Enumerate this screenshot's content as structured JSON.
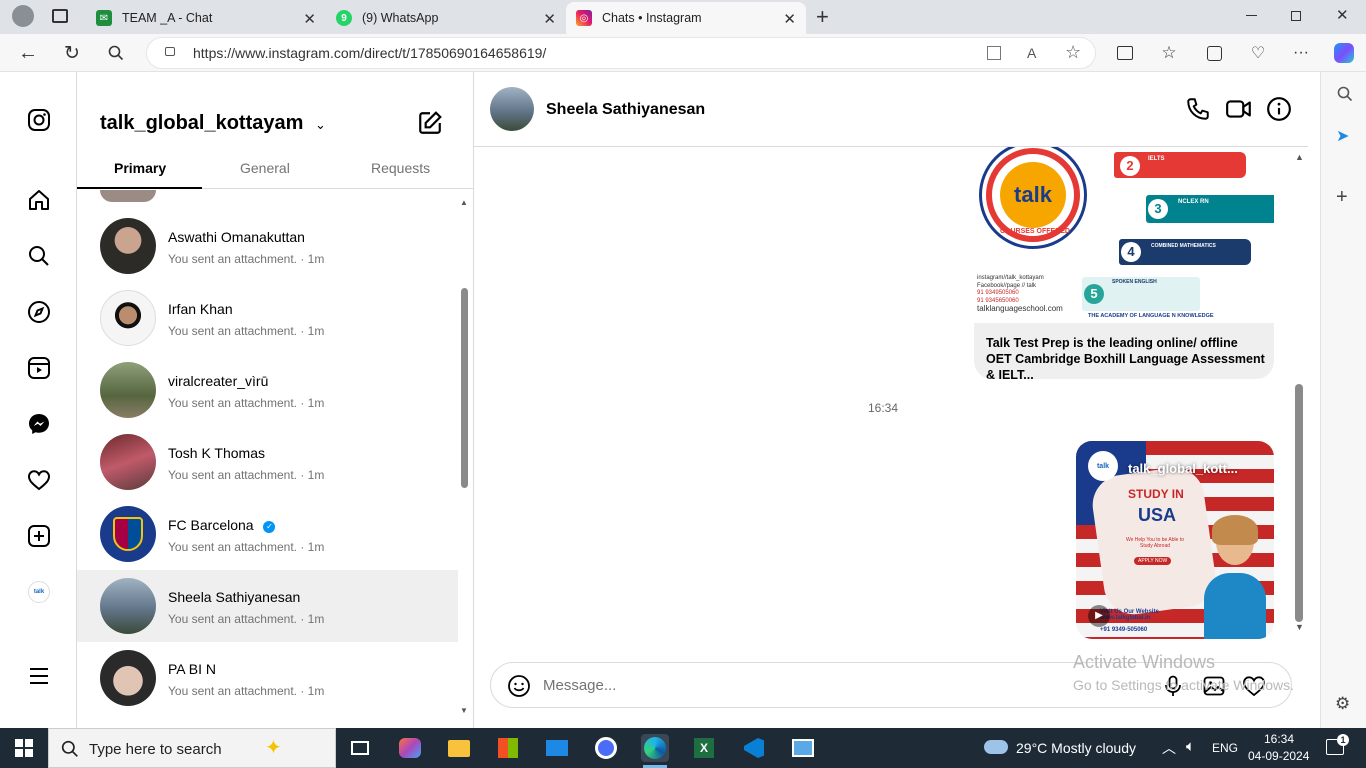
{
  "browser": {
    "tabs": [
      {
        "title": "TEAM _A - Chat",
        "icon": "google-chat-icon"
      },
      {
        "title": "(9) WhatsApp",
        "icon": "whatsapp-icon"
      },
      {
        "title": "Chats • Instagram",
        "icon": "instagram-icon",
        "active": true
      }
    ],
    "url": "https://www.instagram.com/direct/t/17850690164658619/"
  },
  "inbox": {
    "username": "talk_global_kottayam",
    "tabs": [
      "Primary",
      "General",
      "Requests"
    ],
    "active_tab": "Primary",
    "conversations": [
      {
        "name": "Aswathi Omanakuttan",
        "preview": "You sent an attachment. · 1m",
        "avatar_color": "#3b3a35"
      },
      {
        "name": "Irfan Khan",
        "preview": "You sent an attachment. · 1m",
        "avatar_color": "#ffffff"
      },
      {
        "name": "viralcreater_vìrū",
        "preview": "You sent an attachment. · 1m",
        "avatar_color": "#6b7a52"
      },
      {
        "name": "Tosh K Thomas",
        "preview": "You sent an attachment. · 1m",
        "avatar_color": "#8a4a4a"
      },
      {
        "name": "FC Barcelona",
        "preview": "You sent an attachment. · 1m",
        "avatar_color": "#1a3b8c",
        "verified": true
      },
      {
        "name": "Sheela Sathiyanesan",
        "preview": "You sent an attachment. · 1m",
        "avatar_color": "#5a6b7a",
        "selected": true
      },
      {
        "name": "PA BI N",
        "preview": "You sent an attachment. · 1m",
        "avatar_color": "#d9c9c0"
      }
    ]
  },
  "chat": {
    "contact_name": "Sheela Sathiyanesan",
    "card1": {
      "caption": "Talk Test Prep is the leading online/ offline OET Cambridge Boxhill Language Assessment & IELT...",
      "logo_text": "talk",
      "ring_text": "COURSES OFFERED",
      "courses": [
        {
          "num": "2",
          "title": "IELTS",
          "color": "#e53935"
        },
        {
          "num": "3",
          "title": "NCLEX RN",
          "color": "#00838f"
        },
        {
          "num": "4",
          "title": "COMBINED MATHEMATICS",
          "color": "#1a3b6b"
        },
        {
          "num": "5",
          "title": "SPOKEN ENGLISH",
          "color": "#26a69a"
        }
      ],
      "contacts": [
        "instagram//talk_kottayam",
        "Facebook//page // talk",
        "91 9349505060",
        "91 9345650060",
        "talklanguageschool.com"
      ],
      "tagline": "THE ACADEMY OF LANGUAGE N KNOWLEDGE"
    },
    "time_label": "16:34",
    "card2": {
      "account": "talk_global_kott...",
      "headline": "STUDY IN",
      "country": "USA",
      "blurb": "We Help You to be Able to Study Abroad",
      "cta": "APPLY NOW",
      "website": "Visit Us Our Website www.talkglobal.in",
      "phone": "+91 9349-505060"
    },
    "composer_placeholder": "Message..."
  },
  "watermark": {
    "line1": "Activate Windows",
    "line2": "Go to Settings to activate Windows."
  },
  "taskbar": {
    "search_placeholder": "Type here to search",
    "weather": "29°C  Mostly cloudy",
    "lang": "ENG",
    "time": "16:34",
    "date": "04-09-2024",
    "notifications": "1"
  }
}
